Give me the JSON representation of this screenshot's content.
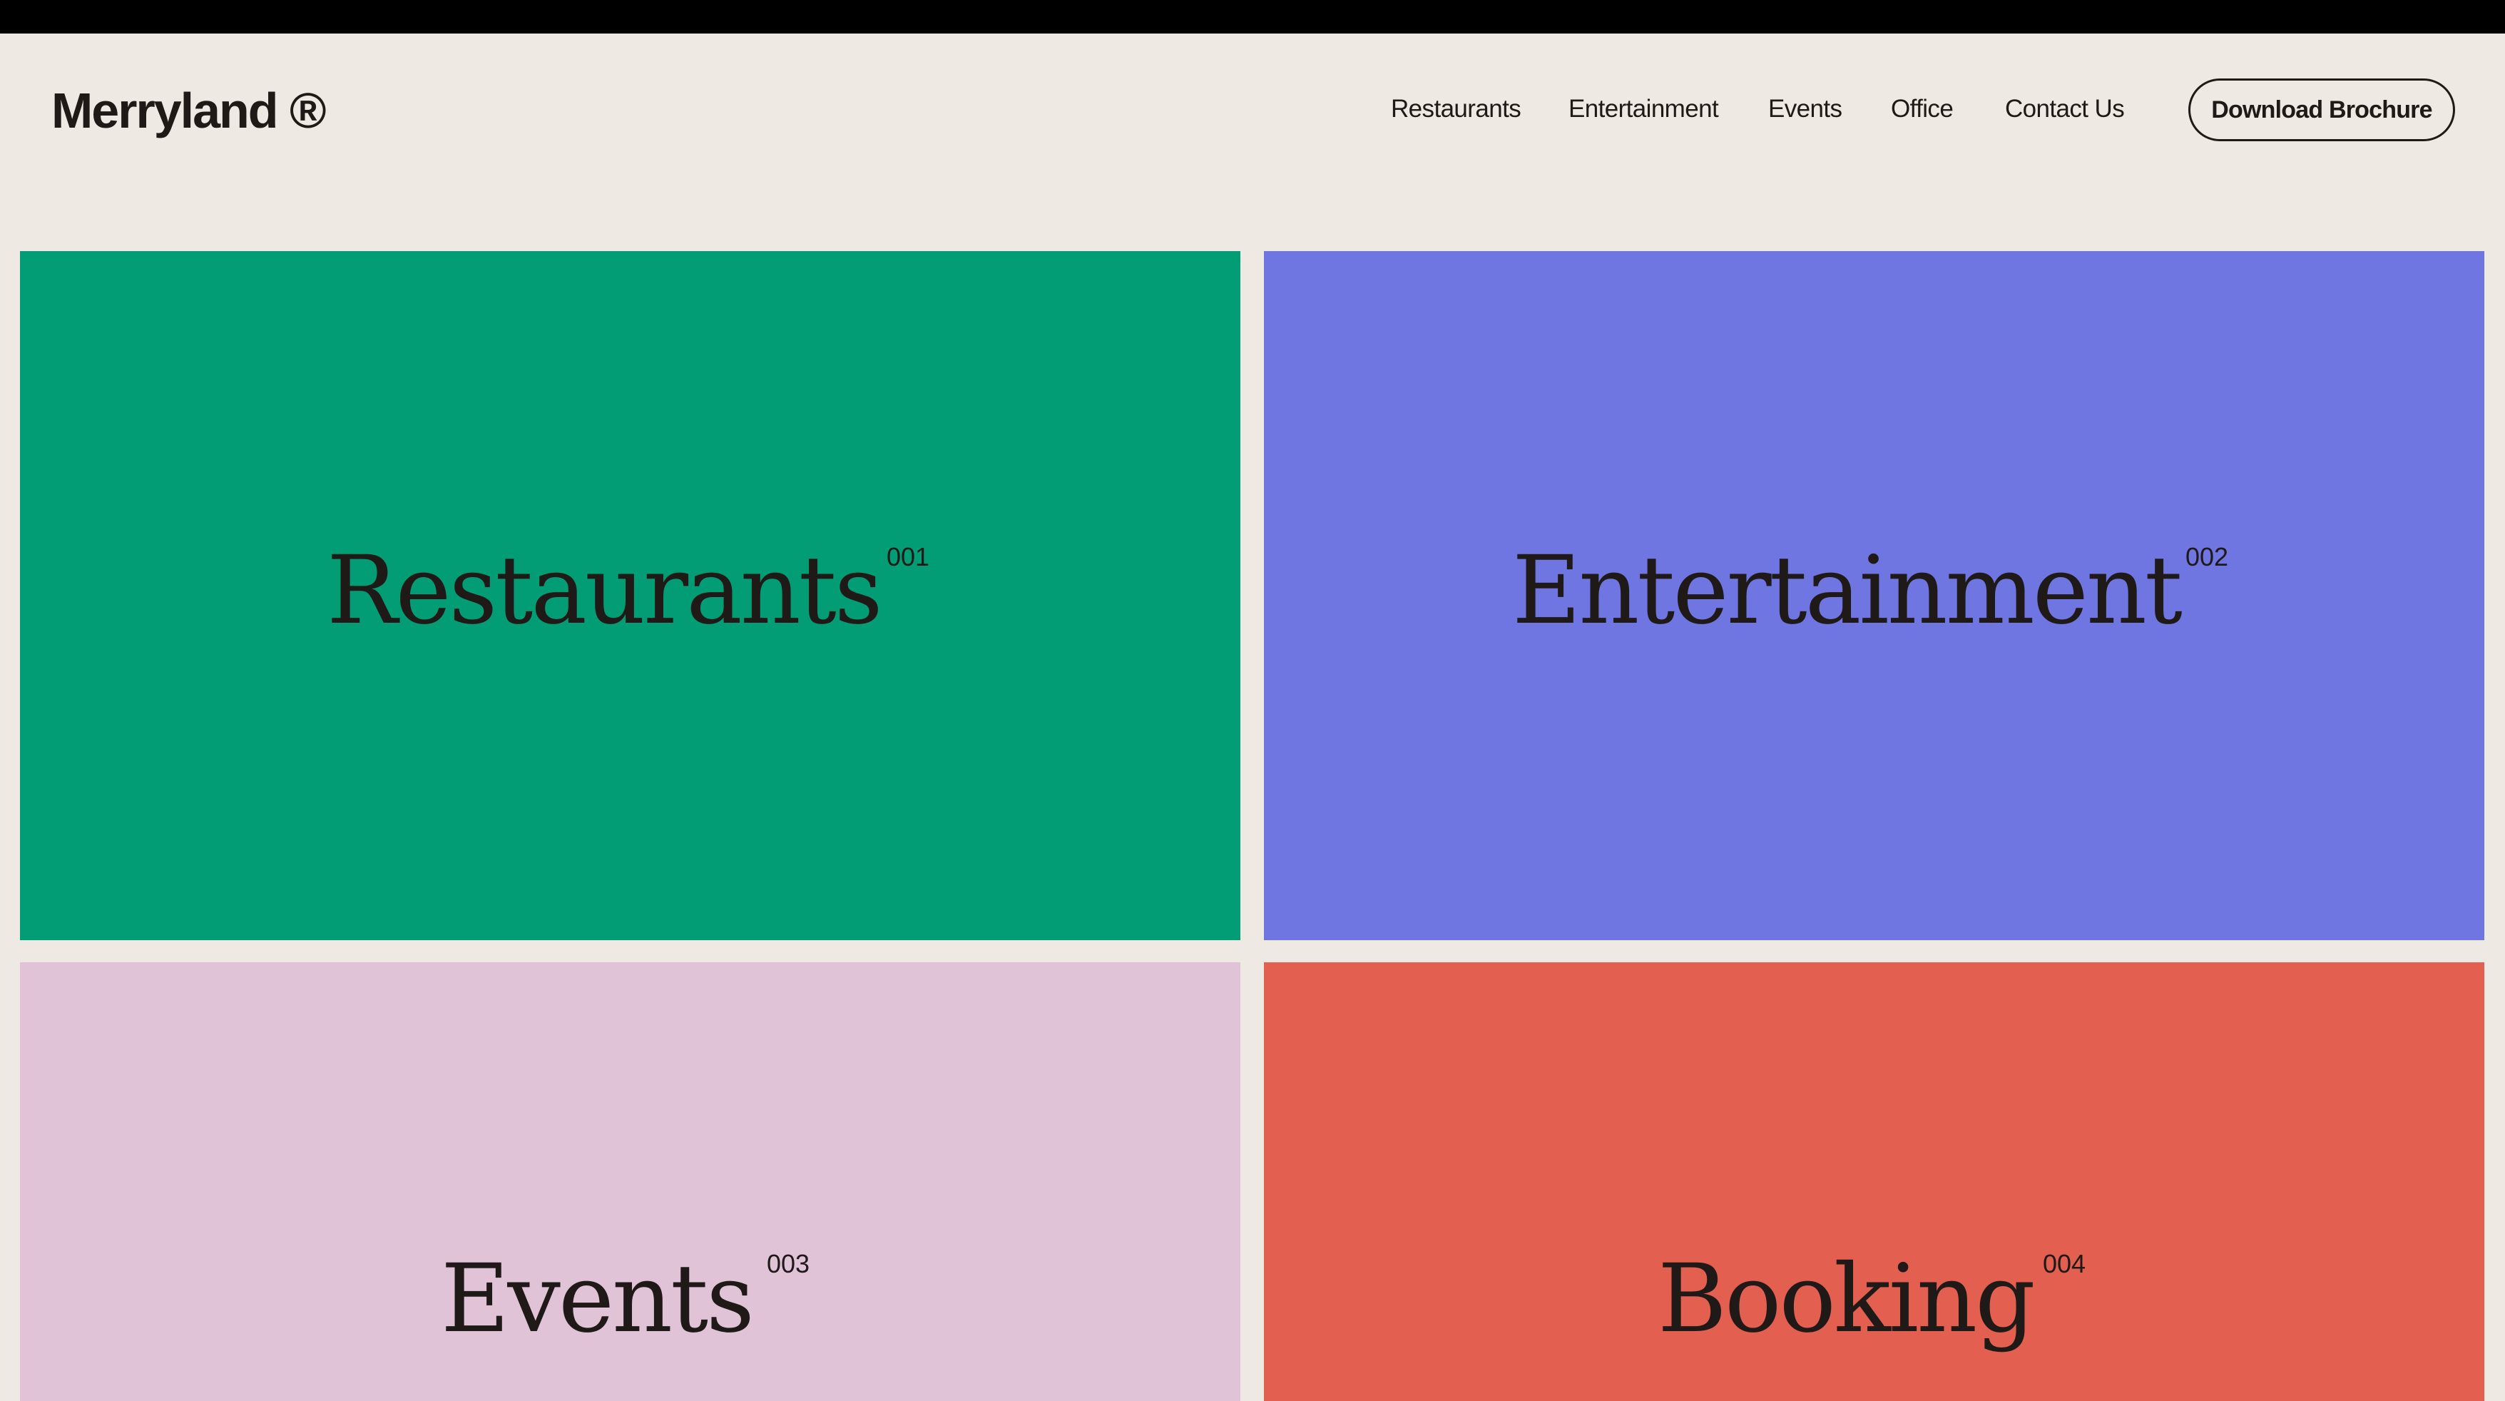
{
  "brand": {
    "logo": "Merryland ®"
  },
  "nav": {
    "items": [
      {
        "label": "Restaurants"
      },
      {
        "label": "Entertainment"
      },
      {
        "label": "Events"
      },
      {
        "label": "Office"
      },
      {
        "label": "Contact Us"
      }
    ],
    "cta_label": "Download Brochure"
  },
  "cards": [
    {
      "title": "Restaurants",
      "number": "001",
      "color": "#029D74"
    },
    {
      "title": "Entertainment",
      "number": "002",
      "color": "#6F76E1"
    },
    {
      "title": "Events",
      "number": "003",
      "color": "#E1C3D8"
    },
    {
      "title": "Booking",
      "number": "004",
      "color": "#E35F50"
    }
  ],
  "colors": {
    "background": "#EEE9E2",
    "text": "#1f1a17"
  }
}
